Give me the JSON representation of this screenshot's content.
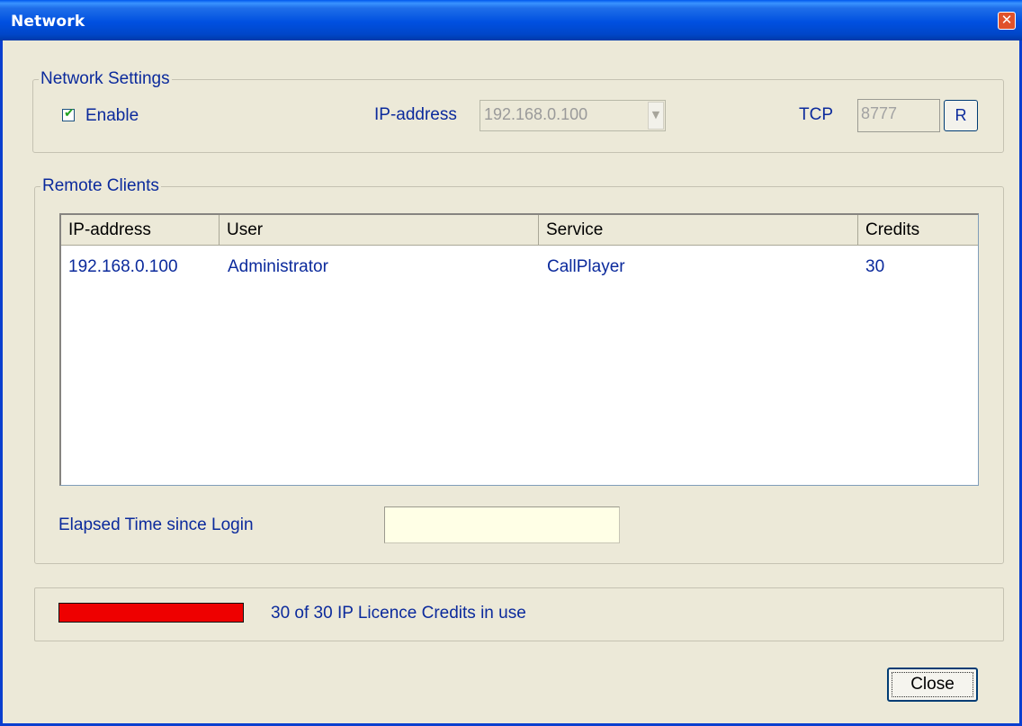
{
  "window": {
    "title": "Network",
    "close_glyph": "✕"
  },
  "network_settings": {
    "legend": "Network Settings",
    "enable_label": "Enable",
    "enable_checked": true,
    "ip_label": "IP-address",
    "ip_value": "192.168.0.100",
    "tcp_label": "TCP",
    "tcp_value": "8777",
    "reset_button": "R"
  },
  "remote_clients": {
    "legend": "Remote Clients",
    "columns": [
      "IP-address",
      "User",
      "Service",
      "Credits"
    ],
    "rows": [
      [
        "192.168.0.100",
        "Administrator",
        "CallPlayer",
        "30"
      ]
    ],
    "elapsed_label": "Elapsed Time since Login",
    "elapsed_value": ""
  },
  "licence": {
    "text": "30 of 30 IP Licence Credits in use",
    "used": 30,
    "total": 30,
    "bar_color": "#ee0000"
  },
  "footer": {
    "close_button": "Close"
  },
  "icons": {
    "checkbox_mark": "✔",
    "dropdown_arrow": "▼"
  }
}
